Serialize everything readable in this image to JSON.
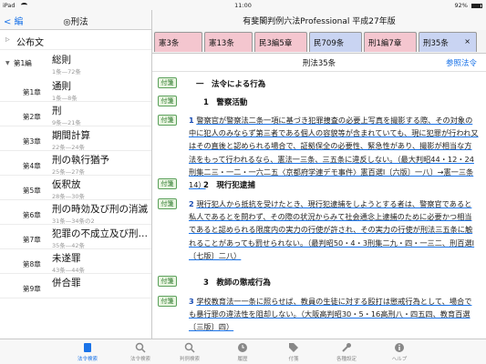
{
  "status": {
    "device": "iPad",
    "time": "11:00",
    "battery": "92%",
    "battery_level": 0.92
  },
  "sidebar": {
    "back_label": "< 編",
    "title": "◎刑法",
    "group_label": "公布文",
    "part": {
      "tag": "第1編",
      "title": "総則",
      "range": "1条—72条"
    },
    "chapters": [
      {
        "tag": "第1章",
        "title": "通則",
        "range": "1条—8条"
      },
      {
        "tag": "第2章",
        "title": "刑",
        "range": "9条—21条"
      },
      {
        "tag": "第3章",
        "title": "期間計算",
        "range": "22条—24条"
      },
      {
        "tag": "第4章",
        "title": "刑の執行猶予",
        "range": "25条—27条"
      },
      {
        "tag": "第5章",
        "title": "仮釈放",
        "range": "28条—30条"
      },
      {
        "tag": "第6章",
        "title": "刑の時効及び刑の消滅",
        "range": "31条—34条の2"
      },
      {
        "tag": "第7章",
        "title": "犯罪の不成立及び刑…",
        "range": "35条—42条"
      },
      {
        "tag": "第8章",
        "title": "未遂罪",
        "range": "43条—44条"
      },
      {
        "tag": "第9章",
        "title": "併合罪",
        "range": ""
      }
    ]
  },
  "main": {
    "title": "有斐閣判例六法Professional 平成27年版",
    "tabs": [
      {
        "label": "憲3条",
        "color": "#f4c6cf"
      },
      {
        "label": "憲13条",
        "color": "#f4c6cf"
      },
      {
        "label": "民3編5章",
        "color": "#f4c6cf"
      },
      {
        "label": "民709条",
        "color": "#c9d4f2"
      },
      {
        "label": "刑1編7章",
        "color": "#f4c6cf"
      },
      {
        "label": "刑35条",
        "color": "#c9d4f2"
      }
    ],
    "tab_close": "×",
    "sub_title": "刑法35条",
    "ref_label": "参照法令",
    "fusen": "付箋",
    "sections": {
      "s1": "一　法令による行為",
      "h1": "1　警察活動",
      "p1_num": "1",
      "p1_text": "警察官が警察法二条一項に基づき犯罪捜査の必要上写真を撮影する際、その対象の中に犯人のみならず第三者である個人の容貌等が含まれていても、現に犯罪が行われ又はその直後と認められる場合で、証拠保全の必要性、緊急性があり、撮影が相当な方法をもって行われるなら、憲法一三条、三五条に違反しない。（最大判昭44・12・24刑集二三・一二・一六二五〈京都府学連デモ事件〉憲百選Ⅰ〔六版〕一八〕→憲一三条14）",
      "h2": "2　現行犯逮捕",
      "p2_num": "2",
      "p2_text": "現行犯人から抵抗を受けたとき、現行犯逮捕をしようとする者は、警察官であると私人であるとを問わず、その際の状況からみて社会通念上逮捕のために必要かつ相当であると認められる限度内の実力の行使が許され、その実力の行使が刑法三五条に触れることがあっても罰せられない。（最判昭50・4・3刑集二九・四・一三二、刑百選Ⅰ〔七版〕二八）",
      "h3": "3　教師の懲戒行為",
      "p3_num": "3",
      "p3_text": "学校教育法一一条に照らせば、教員の生徒に対する殴打は懲戒行為として、場合でも暴行罪の違法性を阻却しない。（大阪高判昭30・5・16高刑八・四五四、教育百選〔三版〕四）"
    }
  },
  "bottom": [
    {
      "label": "法令検索",
      "icon": "book-icon",
      "active": true
    },
    {
      "label": "法令検索",
      "icon": "search-icon",
      "active": false
    },
    {
      "label": "判例検索",
      "icon": "search-icon",
      "active": false
    },
    {
      "label": "履歴",
      "icon": "clock-icon",
      "active": false
    },
    {
      "label": "付箋",
      "icon": "tag-icon",
      "active": false
    },
    {
      "label": "各種設定",
      "icon": "wrench-icon",
      "active": false
    },
    {
      "label": "ヘルプ",
      "icon": "info-icon",
      "active": false
    }
  ]
}
